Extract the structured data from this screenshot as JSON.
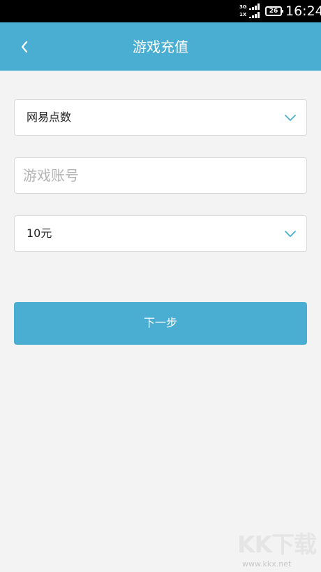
{
  "status_bar": {
    "network_top": "3G",
    "network_bottom": "1X",
    "battery": "26",
    "time": "16:24"
  },
  "header": {
    "back_icon": "chevron-left-icon",
    "title": "游戏充值"
  },
  "form": {
    "game_select": {
      "selected": "网易点数",
      "icon": "chevron-down-icon"
    },
    "account_input": {
      "value": "",
      "placeholder": "游戏账号"
    },
    "amount_select": {
      "selected": "10元",
      "icon": "chevron-down-icon"
    },
    "next_label": "下一步"
  },
  "watermark": {
    "logo": "KK下载",
    "url": "www.kkx.net"
  },
  "colors": {
    "accent": "#4aaed3",
    "background": "#f3f3f3",
    "status_bar": "#000000"
  }
}
